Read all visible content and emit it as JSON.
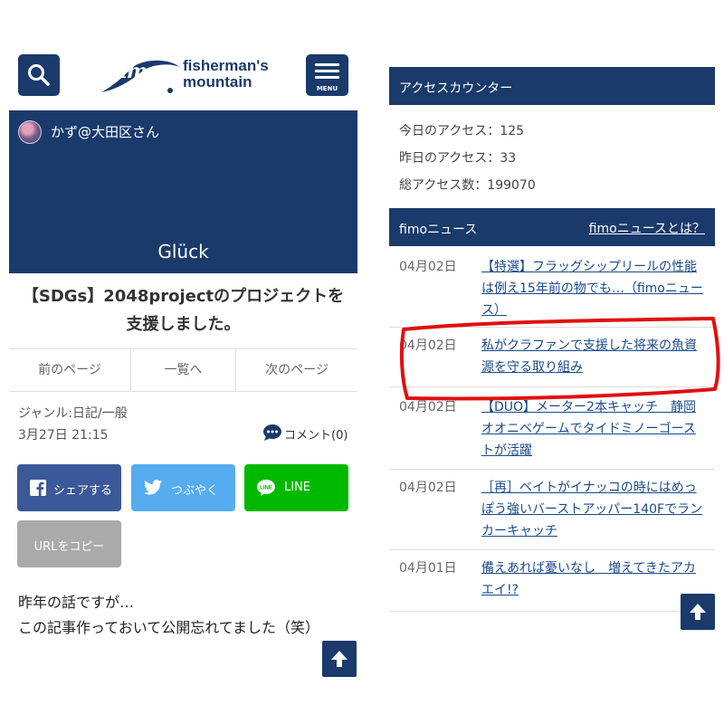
{
  "header": {
    "logo_mark": "fimo",
    "logo_line1": "fisherman's",
    "logo_line2": "mountain",
    "menu_label": "MENU"
  },
  "hero": {
    "user": "かず@大田区さん",
    "blog_title": "Glück"
  },
  "article": {
    "title_line1": "【SDGs】2048projectのプロジェクトを",
    "title_line2": "支援しました。",
    "prev": "前のページ",
    "list": "一覧へ",
    "next": "次のページ",
    "genre": "ジャンル:日記/一般",
    "date": "3月27日 21:15",
    "comment": "コメント(0)",
    "body_line1": "昨年の話ですが…",
    "body_line2": "この記事作っておいて公開忘れてました（笑）"
  },
  "share": {
    "facebook": "シェアする",
    "twitter": "つぶやく",
    "line": "LINE",
    "copy_url": "URLをコピー"
  },
  "access_counter": {
    "title": "アクセスカウンター",
    "today": "今日のアクセス：125",
    "yesterday": "昨日のアクセス：33",
    "total": "総アクセス数：199070"
  },
  "fimo_news": {
    "title": "fimoニュース",
    "about_link": "fimoニュースとは？",
    "items": [
      {
        "date": "04月02日",
        "title": "【特選】フラッグシップリールの性能は例え15年前の物でも…（fimoニュース）"
      },
      {
        "date": "04月02日",
        "title": "私がクラファンで支援した将来の魚資源を守る取り組み"
      },
      {
        "date": "04月02日",
        "title": "【DUO】メーター2本キャッチ　静岡オオニベゲームでタイドミノーゴーストが活躍"
      },
      {
        "date": "04月02日",
        "title": "［再］ベイトがイナッコの時にはめっぽう強いバーストアッパー140Fでランカーキャッチ"
      },
      {
        "date": "04月01日",
        "title": "備えあれば憂いなし　増えてきたアカエイ!?"
      }
    ]
  },
  "colors": {
    "navy": "#1a3a6b",
    "facebook": "#3b5998",
    "twitter": "#55acee",
    "line": "#00b900",
    "highlight": "#e01010"
  }
}
